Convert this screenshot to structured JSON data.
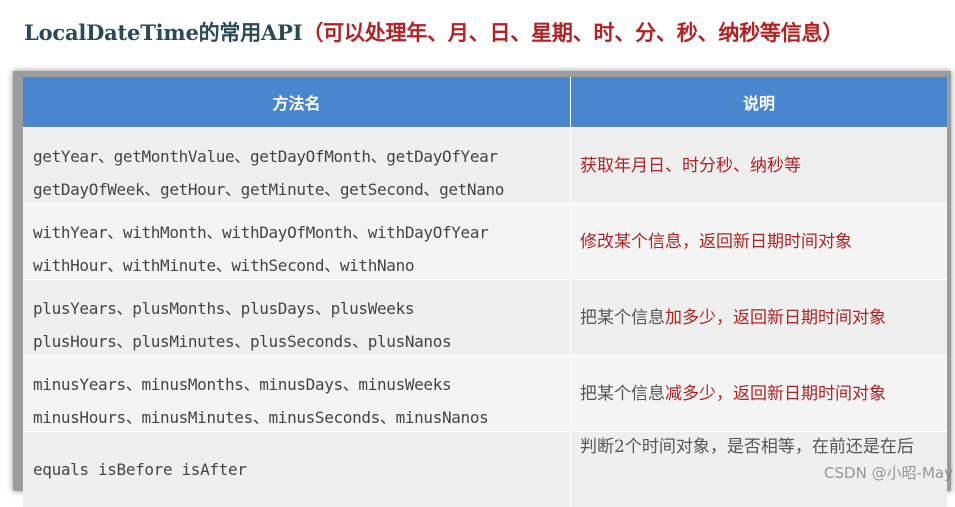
{
  "title": {
    "main": "LocalDateTime的常用API",
    "sub": "（可以处理年、月、日、星期、时、分、秒、纳秒等信息）"
  },
  "table": {
    "headers": [
      "方法名",
      "说明"
    ],
    "rows": [
      {
        "methods": [
          "getYear、getMonthValue、getDayOfMonth、getDayOfYear",
          "getDayOfWeek、getHour、getMinute、getSecond、getNano"
        ],
        "desc": [
          {
            "text": "获取年月日、时分秒、纳秒等",
            "color": "red"
          }
        ]
      },
      {
        "methods": [
          "withYear、withMonth、withDayOfMonth、withDayOfYear",
          "withHour、withMinute、withSecond、withNano"
        ],
        "desc": [
          {
            "text": "修改某个信息，返回新日期时间对象",
            "color": "red"
          }
        ]
      },
      {
        "methods": [
          "plusYears、plusMonths、plusDays、plusWeeks",
          "plusHours、plusMinutes、plusSeconds、plusNanos"
        ],
        "desc": [
          {
            "text": "把某个信息",
            "color": "gray"
          },
          {
            "text": "加多少",
            "color": "red"
          },
          {
            "text": "，返回新日期时间对象",
            "color": "red"
          }
        ]
      },
      {
        "methods": [
          "minusYears、minusMonths、minusDays、minusWeeks",
          "minusHours、minusMinutes、minusSeconds、minusNanos"
        ],
        "desc": [
          {
            "text": "把某个信息",
            "color": "gray"
          },
          {
            "text": "减多少",
            "color": "red"
          },
          {
            "text": "，返回新日期时间对象",
            "color": "red"
          }
        ]
      },
      {
        "methods": [
          "equals isBefore isAfter"
        ],
        "desc": [
          {
            "text": "判断2个时间对象，是否相等，在前还是在后",
            "color": "gray"
          }
        ]
      }
    ]
  },
  "watermark": "CSDN @小昭-May",
  "colors": {
    "header_bg": "#4a86cf",
    "title_main": "#2b4a57",
    "title_sub": "#b22222",
    "desc_red": "#b22222",
    "desc_gray": "#555555"
  }
}
